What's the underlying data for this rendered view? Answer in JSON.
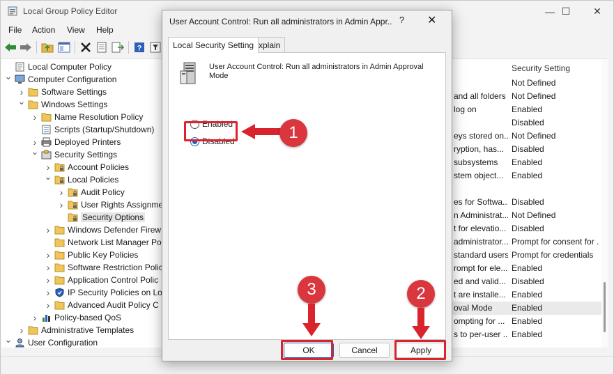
{
  "window": {
    "title": "Local Group Policy Editor",
    "controls": {
      "minimize": "—",
      "maximize": "☐",
      "close": "✕"
    }
  },
  "menu": [
    "File",
    "Action",
    "View",
    "Help"
  ],
  "tree": [
    {
      "label": "Local Computer Policy",
      "icon": "computer-policy-icon",
      "depth": 0,
      "twisty": ""
    },
    {
      "label": "Computer Configuration",
      "icon": "computer-icon",
      "depth": 0,
      "twisty": "v"
    },
    {
      "label": "Software Settings",
      "icon": "folder-icon",
      "depth": 1,
      "twisty": ">"
    },
    {
      "label": "Windows Settings",
      "icon": "folder-icon",
      "depth": 1,
      "twisty": "v"
    },
    {
      "label": "Name Resolution Policy",
      "icon": "folder-icon",
      "depth": 2,
      "twisty": ">"
    },
    {
      "label": "Scripts (Startup/Shutdown)",
      "icon": "script-icon",
      "depth": 2,
      "twisty": ""
    },
    {
      "label": "Deployed Printers",
      "icon": "printer-icon",
      "depth": 2,
      "twisty": ">"
    },
    {
      "label": "Security Settings",
      "icon": "security-icon",
      "depth": 2,
      "twisty": "v"
    },
    {
      "label": "Account Policies",
      "icon": "folder-lock-icon",
      "depth": 3,
      "twisty": ">"
    },
    {
      "label": "Local Policies",
      "icon": "folder-lock-icon",
      "depth": 3,
      "twisty": "v"
    },
    {
      "label": "Audit Policy",
      "icon": "folder-lock-icon",
      "depth": 4,
      "twisty": ">"
    },
    {
      "label": "User Rights Assignme",
      "icon": "folder-lock-icon",
      "depth": 4,
      "twisty": ">"
    },
    {
      "label": "Security Options",
      "icon": "folder-lock-icon",
      "depth": 4,
      "twisty": "",
      "selected": true
    },
    {
      "label": "Windows Defender Firew",
      "icon": "folder-icon",
      "depth": 3,
      "twisty": ">"
    },
    {
      "label": "Network List Manager Po",
      "icon": "folder-icon",
      "depth": 3,
      "twisty": ""
    },
    {
      "label": "Public Key Policies",
      "icon": "folder-icon",
      "depth": 3,
      "twisty": ">"
    },
    {
      "label": "Software Restriction Polic",
      "icon": "folder-icon",
      "depth": 3,
      "twisty": ">"
    },
    {
      "label": "Application Control Polic",
      "icon": "folder-icon",
      "depth": 3,
      "twisty": ">"
    },
    {
      "label": "IP Security Policies on Lo",
      "icon": "ipsec-icon",
      "depth": 3,
      "twisty": ">"
    },
    {
      "label": "Advanced Audit Policy C",
      "icon": "folder-icon",
      "depth": 3,
      "twisty": ">"
    },
    {
      "label": "Policy-based QoS",
      "icon": "chart-icon",
      "depth": 2,
      "twisty": ">"
    },
    {
      "label": "Administrative Templates",
      "icon": "folder-icon",
      "depth": 1,
      "twisty": ">"
    },
    {
      "label": "User Configuration",
      "icon": "user-icon",
      "depth": 0,
      "twisty": "v"
    }
  ],
  "list": {
    "header_setting": "Security Setting",
    "rows": [
      {
        "policy": "",
        "setting": "Not Defined"
      },
      {
        "policy": "and all folders",
        "setting": "Not Defined"
      },
      {
        "policy": "log on",
        "setting": "Enabled"
      },
      {
        "policy": "",
        "setting": "Disabled"
      },
      {
        "policy": "eys stored on...",
        "setting": "Not Defined"
      },
      {
        "policy": "ryption, has...",
        "setting": "Disabled"
      },
      {
        "policy": "subsystems",
        "setting": "Enabled"
      },
      {
        "policy": "stem object...",
        "setting": "Enabled"
      },
      {
        "policy": "",
        "setting": ""
      },
      {
        "policy": "es for Softwa...",
        "setting": "Disabled"
      },
      {
        "policy": "n Administrat...",
        "setting": "Not Defined"
      },
      {
        "policy": "t for elevatio...",
        "setting": "Disabled"
      },
      {
        "policy": "administrator...",
        "setting": "Prompt for consent for ."
      },
      {
        "policy": "standard users",
        "setting": "Prompt for credentials"
      },
      {
        "policy": "rompt for ele...",
        "setting": "Enabled"
      },
      {
        "policy": "ed and valid...",
        "setting": "Disabled"
      },
      {
        "policy": "t are installe...",
        "setting": "Enabled"
      },
      {
        "policy": "oval Mode",
        "setting": "Enabled",
        "selected": true
      },
      {
        "policy": "ompting for ...",
        "setting": "Enabled"
      },
      {
        "policy": "s to per-user ...",
        "setting": "Enabled"
      }
    ]
  },
  "dialog": {
    "title": "User Account Control: Run all administrators in Admin Appr...",
    "help": "?",
    "close": "✕",
    "tabs": [
      "Local Security Setting",
      "Explain"
    ],
    "policy_text": "User Account Control: Run all administrators in Admin Approval Mode",
    "options": [
      {
        "label": "Enabled",
        "checked": false
      },
      {
        "label": "Disabled",
        "checked": true
      }
    ],
    "buttons": {
      "ok": "OK",
      "cancel": "Cancel",
      "apply": "Apply"
    }
  },
  "annotations": {
    "step1": "1",
    "step2": "2",
    "step3": "3",
    "color": "#d9232d"
  }
}
